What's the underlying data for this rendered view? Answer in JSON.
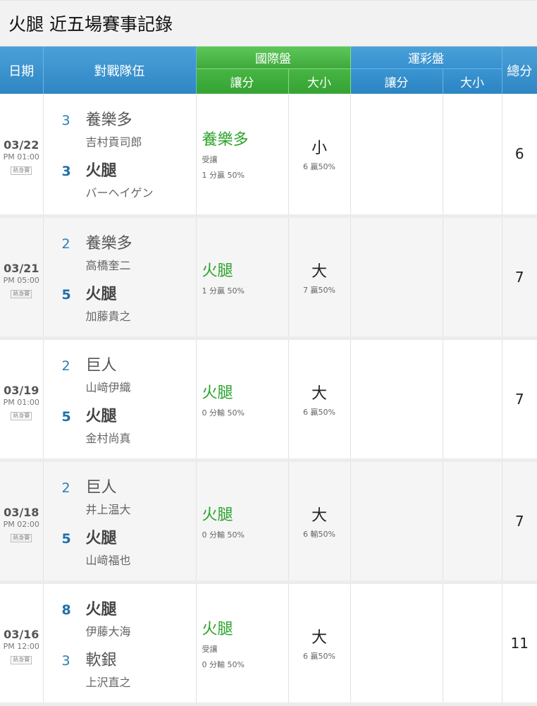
{
  "title": "火腿 近五場賽事記錄",
  "headers": {
    "date": "日期",
    "matchup": "對戰隊伍",
    "intl": "國際盤",
    "lottery": "運彩盤",
    "spread": "讓分",
    "total": "大小",
    "score_total": "總分"
  },
  "games": [
    {
      "date": "03/22",
      "time": "PM 01:00",
      "tag": "熱身賽",
      "away": {
        "score": "3",
        "name": "養樂多",
        "pitcher": "吉村貢司郎"
      },
      "home": {
        "score": "3",
        "name": "火腿",
        "pitcher": "バーヘイゲン"
      },
      "spread_team": "養樂多",
      "spread_note": "受讓",
      "spread_result": "1 分贏 50%",
      "total_pick": "小",
      "total_result": "6 贏50%",
      "score_total": "6"
    },
    {
      "date": "03/21",
      "time": "PM 05:00",
      "tag": "熱身賽",
      "away": {
        "score": "2",
        "name": "養樂多",
        "pitcher": "高橋奎二"
      },
      "home": {
        "score": "5",
        "name": "火腿",
        "pitcher": "加藤貴之"
      },
      "spread_team": "火腿",
      "spread_note": "",
      "spread_result": "1 分贏 50%",
      "total_pick": "大",
      "total_result": "7 贏50%",
      "score_total": "7"
    },
    {
      "date": "03/19",
      "time": "PM 01:00",
      "tag": "熱身賽",
      "away": {
        "score": "2",
        "name": "巨人",
        "pitcher": "山﨑伊織"
      },
      "home": {
        "score": "5",
        "name": "火腿",
        "pitcher": "金村尚真"
      },
      "spread_team": "火腿",
      "spread_note": "",
      "spread_result": "0 分輸 50%",
      "total_pick": "大",
      "total_result": "6 贏50%",
      "score_total": "7"
    },
    {
      "date": "03/18",
      "time": "PM 02:00",
      "tag": "熱身賽",
      "away": {
        "score": "2",
        "name": "巨人",
        "pitcher": "井上温大"
      },
      "home": {
        "score": "5",
        "name": "火腿",
        "pitcher": "山﨑福也"
      },
      "spread_team": "火腿",
      "spread_note": "",
      "spread_result": "0 分輸 50%",
      "total_pick": "大",
      "total_result": "6 輸50%",
      "score_total": "7"
    },
    {
      "date": "03/16",
      "time": "PM 12:00",
      "tag": "熱身賽",
      "away": {
        "score": "8",
        "name": "火腿",
        "pitcher": "伊藤大海"
      },
      "home": {
        "score": "3",
        "name": "軟銀",
        "pitcher": "上沢直之"
      },
      "spread_team": "火腿",
      "spread_note": "受讓",
      "spread_result": "0 分輸 50%",
      "total_pick": "大",
      "total_result": "6 贏50%",
      "score_total": "11"
    }
  ]
}
